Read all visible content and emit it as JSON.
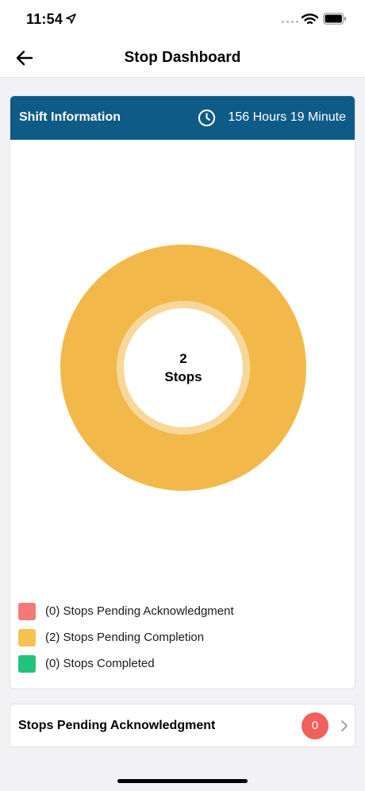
{
  "status_bar": {
    "time": "11:54"
  },
  "nav": {
    "title": "Stop Dashboard"
  },
  "shift": {
    "title": "Shift Information",
    "duration": "156 Hours 19 Minute"
  },
  "chart_data": {
    "type": "pie",
    "center_value": "2",
    "center_label": "Stops",
    "slices": [
      {
        "label": "(0) Stops Pending Acknowledgment",
        "value": 0,
        "color": "#f47a77"
      },
      {
        "label": "(2) Stops Pending Completion",
        "value": 2,
        "color": "#f2b94a"
      },
      {
        "label": "(0) Stops Completed",
        "value": 0,
        "color": "#22c47b"
      }
    ],
    "legend_position": "bottom-left"
  },
  "legend": [
    {
      "label": "(0) Stops Pending Acknowledgment",
      "color": "#f47a77"
    },
    {
      "label": "(2) Stops Pending Completion",
      "color": "#f5c352"
    },
    {
      "label": "(0) Stops Completed",
      "color": "#22c47b"
    }
  ],
  "ack_row": {
    "label": "Stops Pending Acknowledgment",
    "count": "0"
  },
  "colors": {
    "header": "#0d5b86",
    "badge": "#f0605d"
  }
}
